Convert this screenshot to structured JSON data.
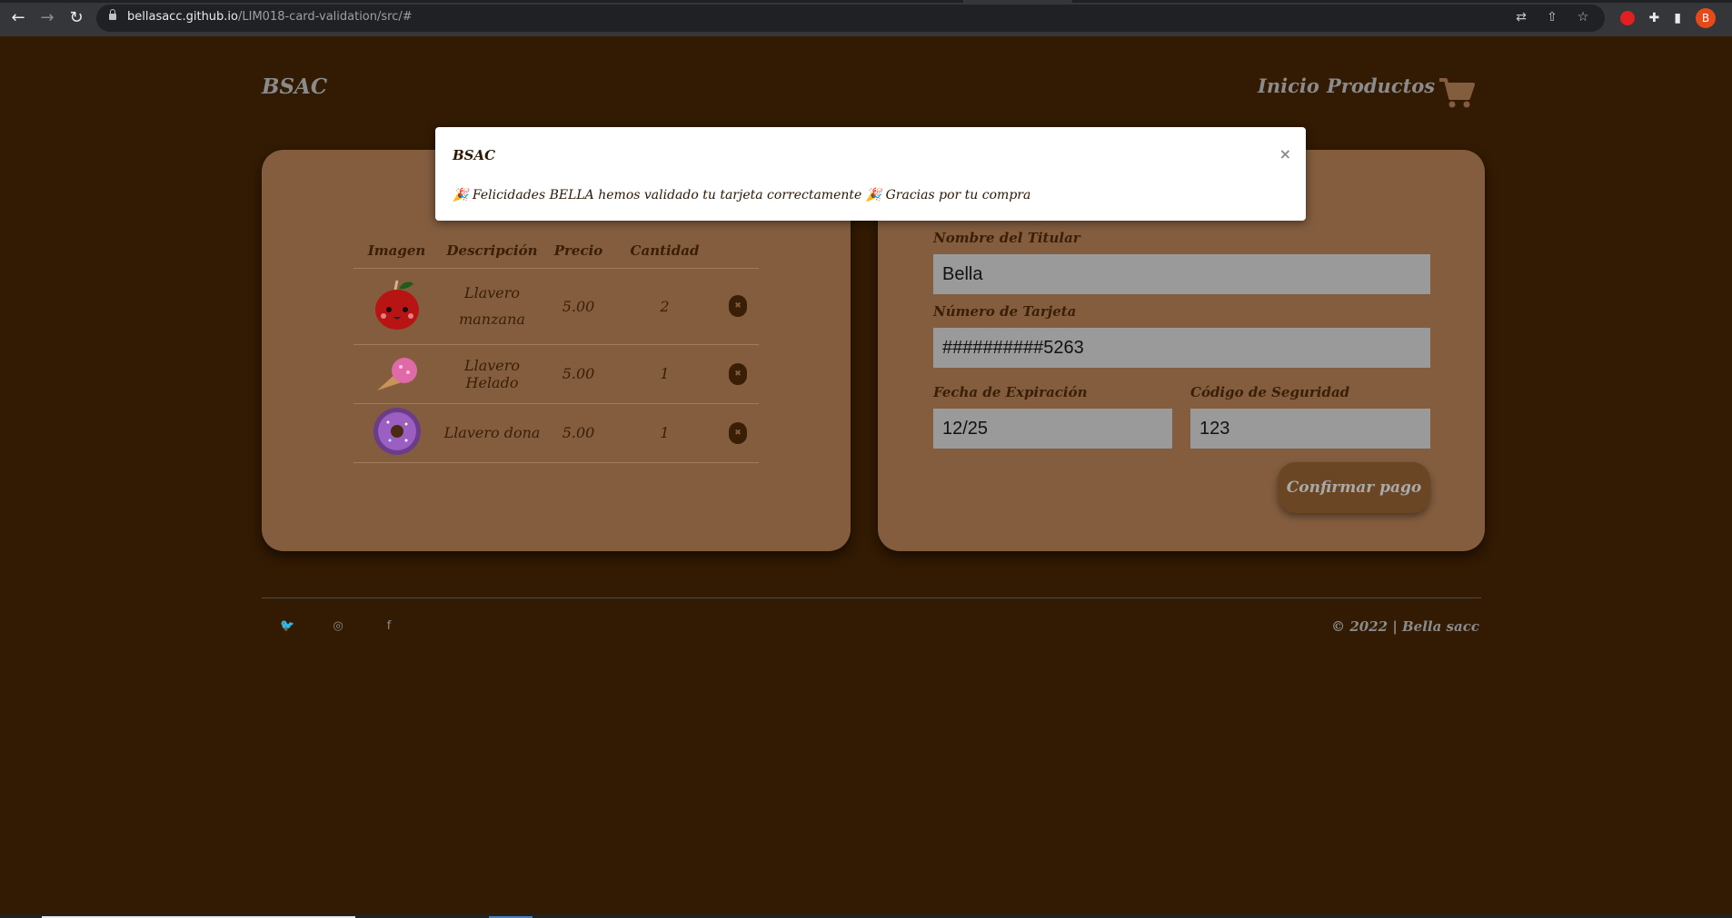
{
  "browser": {
    "url_host": "bellasacc.github.io",
    "url_path": "/LIM018-card-validation/src/#",
    "profile_initial": "B"
  },
  "header": {
    "logo": "BSAC",
    "nav": [
      "Inicio",
      "Productos"
    ]
  },
  "cart": {
    "columns": [
      "Imagen",
      "Descripción",
      "Precio",
      "Cantidad"
    ],
    "rows": [
      {
        "description": "Llavero manzana",
        "price": "5.00",
        "quantity": "2",
        "image": "apple-keychain"
      },
      {
        "description": "Llavero Helado",
        "price": "5.00",
        "quantity": "1",
        "image": "icecream-keychain"
      },
      {
        "description": "Llavero dona",
        "price": "5.00",
        "quantity": "1",
        "image": "donut-keychain"
      }
    ]
  },
  "payment_form": {
    "holder_label": "Nombre del Titular",
    "holder_value": "Bella",
    "card_label": "Número de Tarjeta",
    "card_value": "##########5263",
    "expiry_label": "Fecha de Expiración",
    "expiry_value": "12/25",
    "cvv_label": "Código de Seguridad",
    "cvv_value": "123",
    "confirm_label": "Confirmar pago"
  },
  "modal": {
    "title": "BSAC",
    "close": "×",
    "message": "🎉 Felicidades BELLA hemos validado tu tarjeta correctamente 🎉 Gracias por tu compra"
  },
  "footer": {
    "social": [
      "twitter-icon",
      "instagram-icon",
      "facebook-icon"
    ],
    "copyright": "© 2022 | Bella sacc"
  },
  "colors": {
    "page_bg": "#321a03",
    "card_bg": "#835d3e",
    "text_dark": "#3a1e05",
    "text_muted": "#8b8b8b"
  }
}
